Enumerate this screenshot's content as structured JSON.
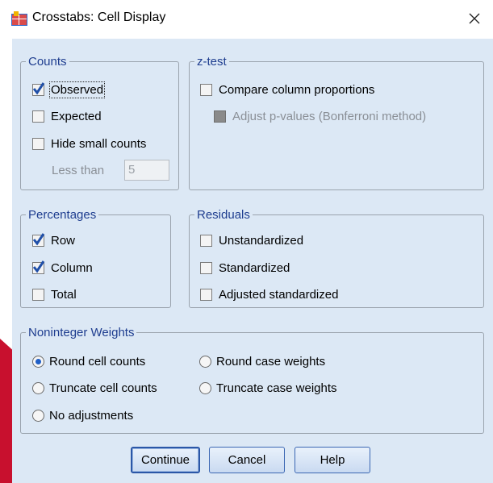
{
  "window": {
    "title": "Crosstabs: Cell Display",
    "close_symbol": "✕"
  },
  "counts": {
    "legend": "Counts",
    "observed": {
      "label": "Observed",
      "checked": true
    },
    "expected": {
      "label": "Expected",
      "checked": false
    },
    "hide_small": {
      "label": "Hide small counts",
      "checked": false
    },
    "less_than_label": "Less than",
    "less_than_value": "5"
  },
  "ztest": {
    "legend": "z-test",
    "compare": {
      "label": "Compare column proportions",
      "checked": false
    },
    "adjust": {
      "label": "Adjust p-values (Bonferroni method)",
      "checked": false,
      "enabled": false
    }
  },
  "percentages": {
    "legend": "Percentages",
    "row": {
      "label": "Row",
      "checked": true
    },
    "column": {
      "label": "Column",
      "checked": true
    },
    "total": {
      "label": "Total",
      "checked": false
    }
  },
  "residuals": {
    "legend": "Residuals",
    "unstandardized": {
      "label": "Unstandardized",
      "checked": false
    },
    "standardized": {
      "label": "Standardized",
      "checked": false
    },
    "adjusted": {
      "label": "Adjusted standardized",
      "checked": false
    }
  },
  "weights": {
    "legend": "Noninteger Weights",
    "options": [
      {
        "label": "Round cell counts",
        "selected": true
      },
      {
        "label": "Round case weights",
        "selected": false
      },
      {
        "label": "Truncate cell counts",
        "selected": false
      },
      {
        "label": "Truncate case weights",
        "selected": false
      },
      {
        "label": "No adjustments",
        "selected": false
      }
    ]
  },
  "buttons": {
    "continue": "Continue",
    "cancel": "Cancel",
    "help": "Help"
  },
  "colors": {
    "accent": "#1e3d8f",
    "client_bg": "#dce8f5",
    "check": "#1f4fa8"
  }
}
